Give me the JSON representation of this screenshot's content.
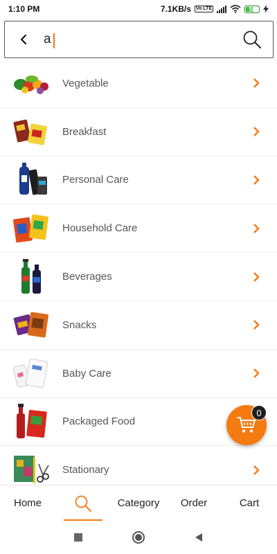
{
  "status_bar": {
    "time": "1:10 PM",
    "network_speed": "7.1KB/s",
    "volte_label": "Vo LTE",
    "battery_level": "56"
  },
  "search": {
    "value": "a",
    "icons": {
      "back": "back-arrow-icon",
      "search": "search-icon"
    }
  },
  "categories": [
    {
      "label": "Vegetable",
      "icon": "vegetable-image"
    },
    {
      "label": "Breakfast",
      "icon": "breakfast-image"
    },
    {
      "label": "Personal Care",
      "icon": "personal-care-image"
    },
    {
      "label": "Household Care",
      "icon": "household-care-image"
    },
    {
      "label": "Beverages",
      "icon": "beverages-image"
    },
    {
      "label": "Snacks",
      "icon": "snacks-image"
    },
    {
      "label": "Baby Care",
      "icon": "baby-care-image"
    },
    {
      "label": "Packaged Food",
      "icon": "packaged-food-image"
    },
    {
      "label": "Stationary",
      "icon": "stationary-image"
    }
  ],
  "cart_fab": {
    "count": "0"
  },
  "bottom_nav": {
    "home": "Home",
    "category": "Category",
    "order": "Order",
    "cart": "Cart"
  },
  "colors": {
    "accent": "#f47b12",
    "text": "#555555"
  }
}
